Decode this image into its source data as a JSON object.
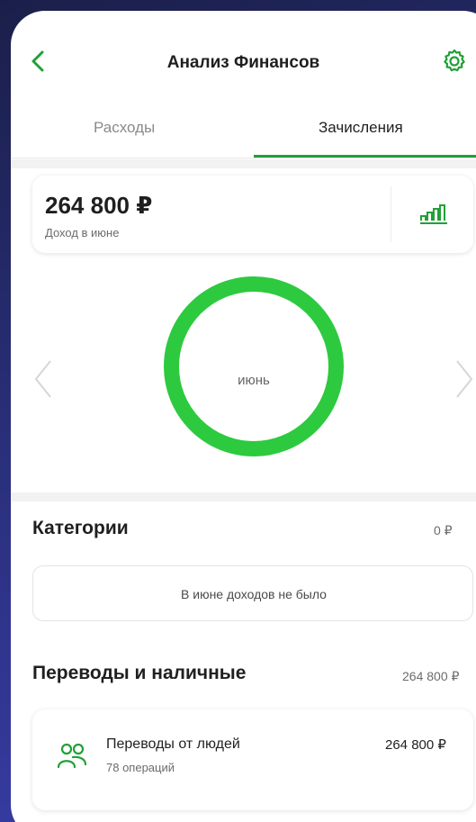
{
  "header": {
    "title": "Анализ Финансов",
    "back_icon": "chevron-left-icon",
    "settings_icon": "gear-icon"
  },
  "tabs": [
    {
      "label": "Расходы",
      "active": false
    },
    {
      "label": "Зачисления",
      "active": true
    }
  ],
  "income_card": {
    "amount": "264 800 ₽",
    "label": "Доход в июне",
    "chart_icon": "bar-chart-icon"
  },
  "donut": {
    "month_label": "июнь",
    "fill_fraction": 1.0,
    "color": "#2dca3f"
  },
  "categories": {
    "title": "Категории",
    "amount": "0 ₽",
    "empty_text": "В июне доходов не было"
  },
  "transfers": {
    "title": "Переводы и наличные",
    "amount": "264 800 ₽",
    "items": [
      {
        "title": "Переводы от людей",
        "subtitle": "78 операций",
        "amount": "264 800 ₽",
        "icon": "people-icon"
      }
    ]
  },
  "colors": {
    "accent": "#21a038",
    "donut": "#2dca3f"
  }
}
